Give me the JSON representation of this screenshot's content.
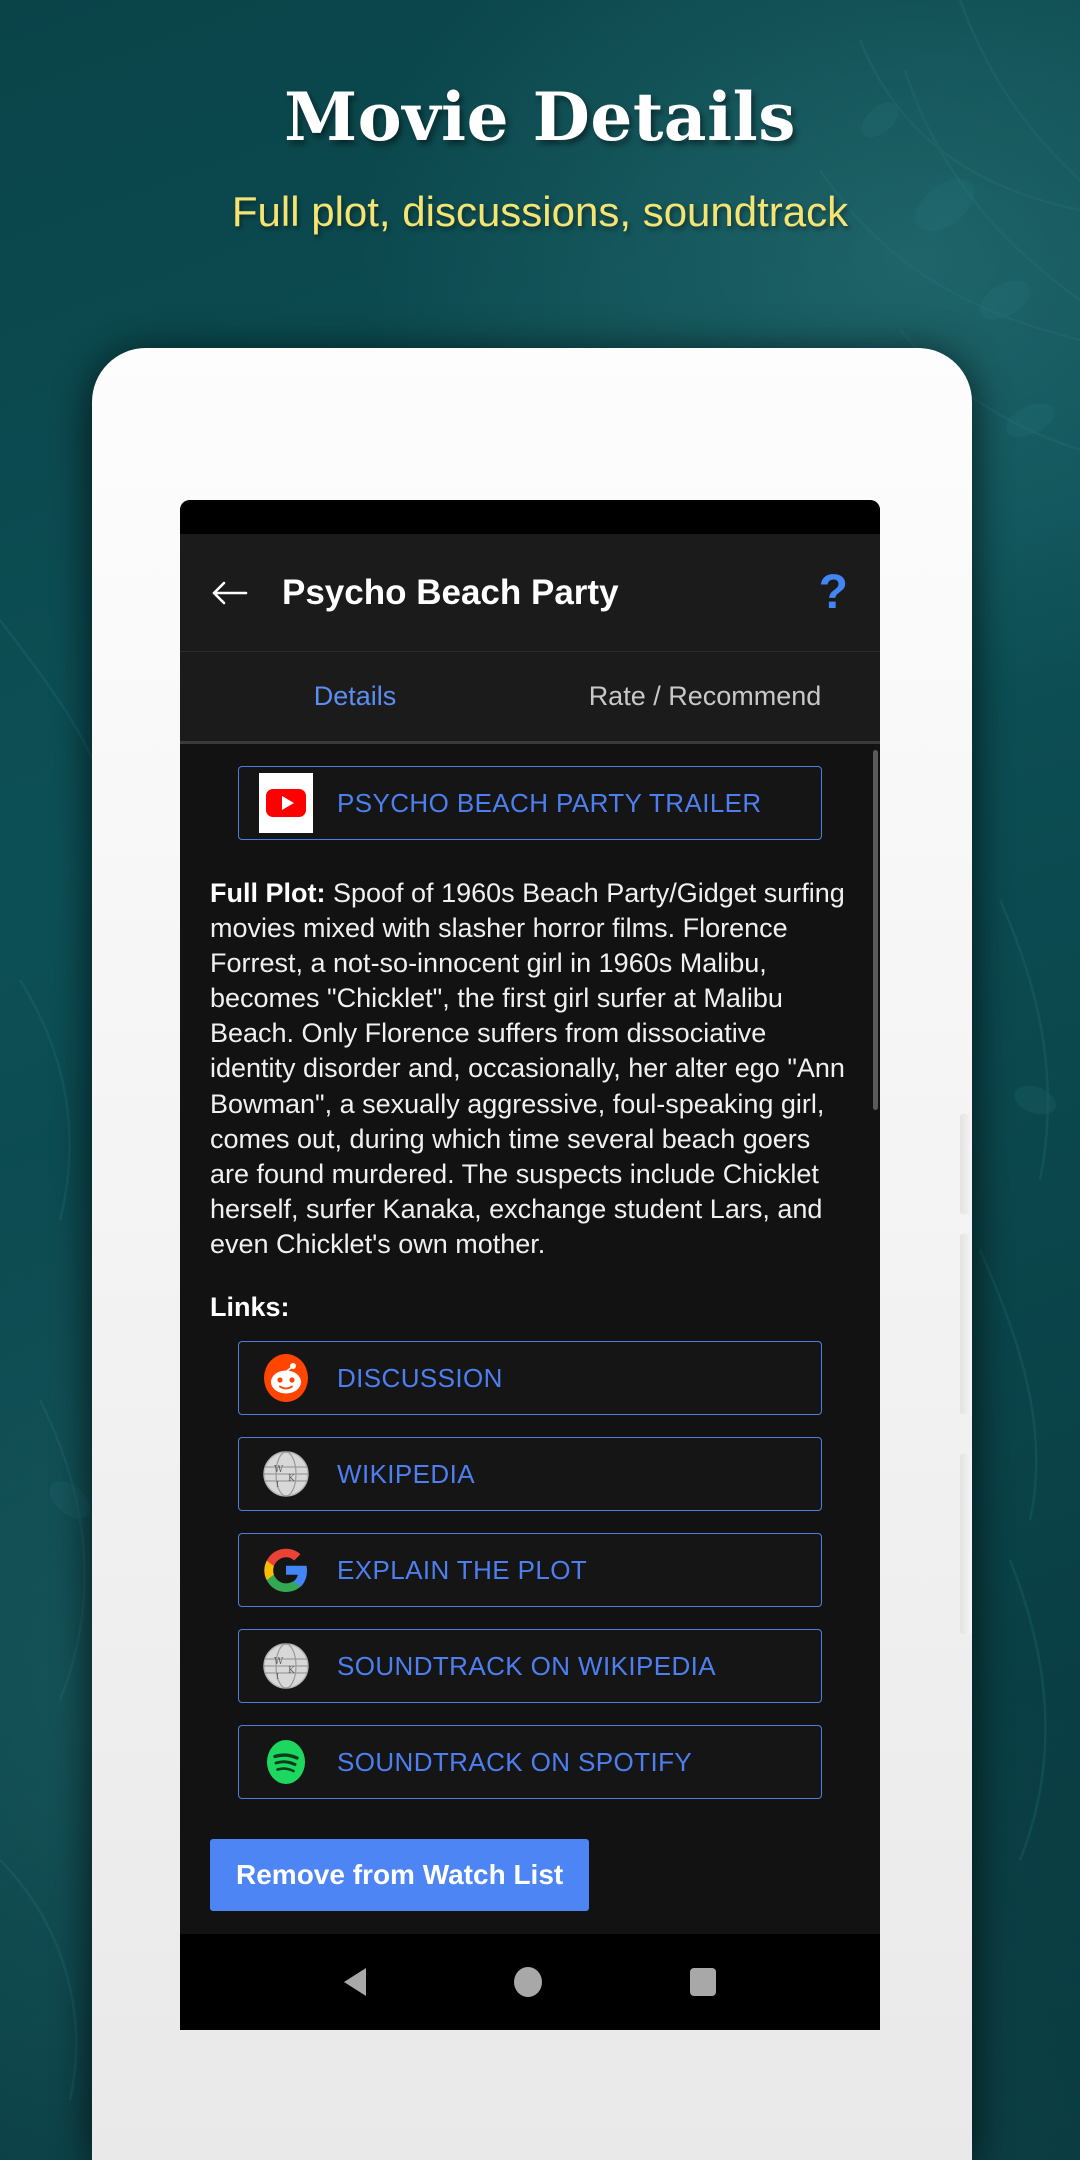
{
  "marketing": {
    "headline": "Movie Details",
    "subheadline": "Full plot, discussions, soundtrack",
    "bg_color": "#0b4a4f",
    "headline_color": "#ffffff",
    "subheadline_color": "#f6e471"
  },
  "appbar": {
    "back_icon": "back-arrow-icon",
    "title": "Psycho Beach Party",
    "help_icon": "?",
    "help_color": "#4285f4",
    "background": "#1b1b1b"
  },
  "tabs": [
    {
      "label": "Details",
      "active": true,
      "color": "#5b8ef0"
    },
    {
      "label": "Rate / Recommend",
      "active": false,
      "color": "#c8c8c8"
    }
  ],
  "trailer": {
    "icon": "youtube-icon",
    "label": "PSYCHO BEACH PARTY TRAILER"
  },
  "plot": {
    "heading": "Full Plot:",
    "body": " Spoof of 1960s Beach Party/Gidget surfing movies mixed with slasher horror films. Florence Forrest, a not-so-innocent girl in 1960s Malibu, becomes \"Chicklet\", the first girl surfer at Malibu Beach. Only Florence suffers from dissociative identity disorder and, occasionally, her alter ego \"Ann Bowman\", a sexually aggressive, foul-speaking girl, comes out, during which time several beach goers are found murdered. The suspects include Chicklet herself, surfer Kanaka, exchange student Lars, and even Chicklet's own mother."
  },
  "links": {
    "label": "Links:",
    "items": [
      {
        "icon": "reddit-icon",
        "label": "DISCUSSION"
      },
      {
        "icon": "wikipedia-icon",
        "label": "WIKIPEDIA"
      },
      {
        "icon": "google-icon",
        "label": "EXPLAIN THE PLOT"
      },
      {
        "icon": "wikipedia-icon",
        "label": "SOUNDTRACK ON WIKIPEDIA"
      },
      {
        "icon": "spotify-icon",
        "label": "SOUNDTRACK ON SPOTIFY"
      }
    ]
  },
  "watch_button": {
    "label": "Remove from Watch List",
    "color": "#4d85f5"
  },
  "navbar": {
    "back": "nav-back-icon",
    "home": "nav-home-icon",
    "recents": "nav-recents-icon"
  }
}
